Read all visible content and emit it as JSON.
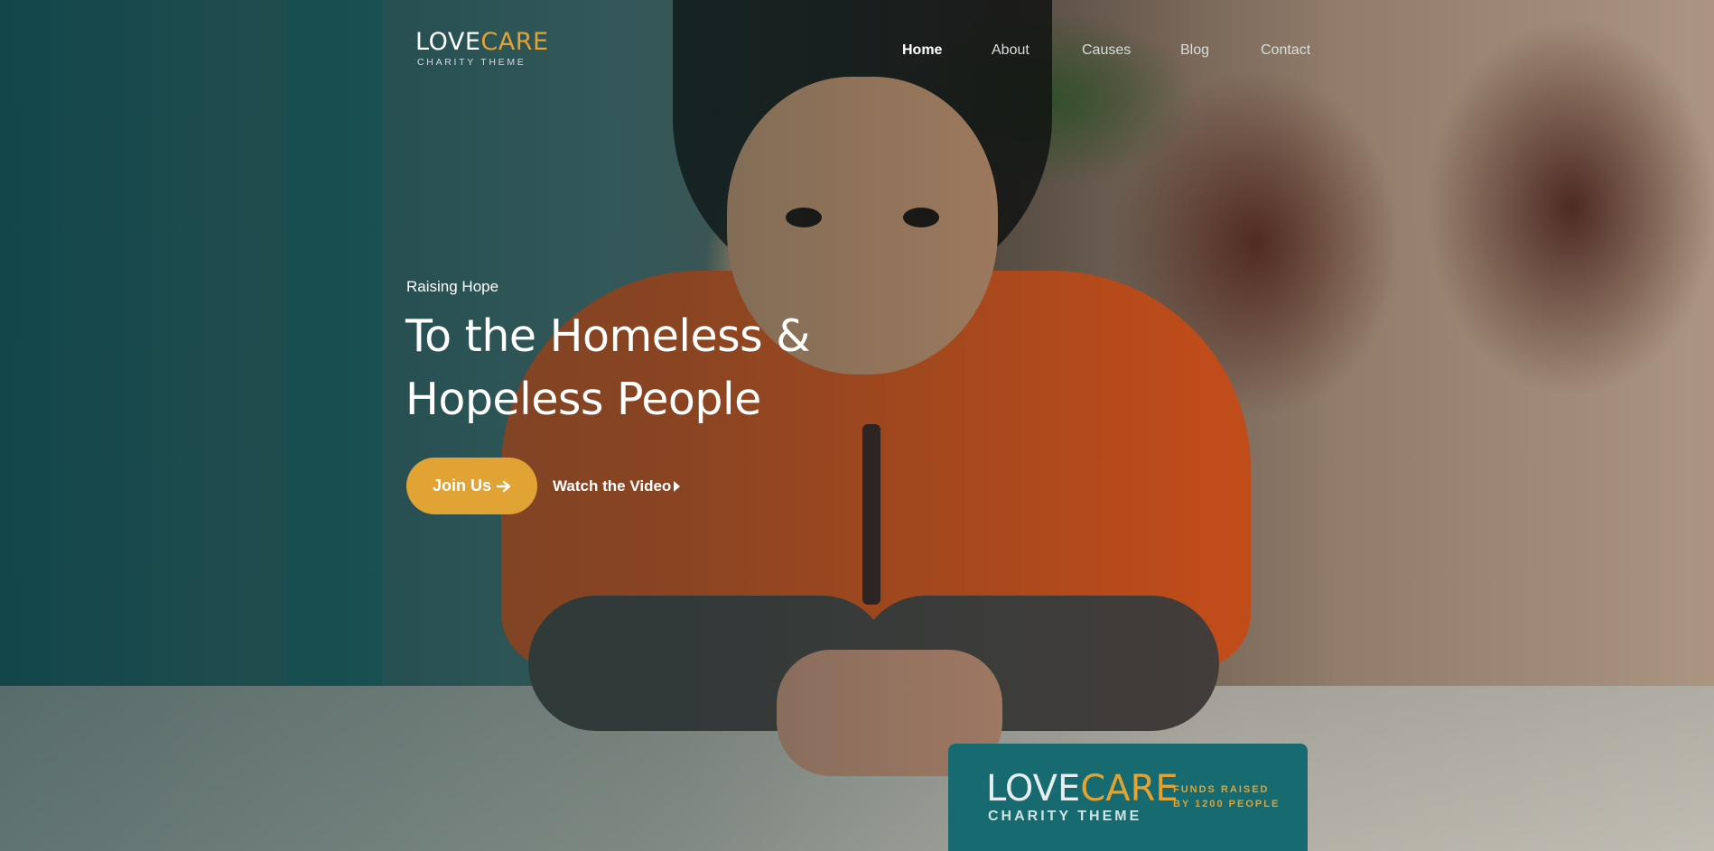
{
  "brand": {
    "word_light": "LOVE",
    "word_accent": "CARE",
    "tagline": "CHARITY THEME",
    "accent_color": "#e0a334",
    "teal_color": "#166a70"
  },
  "nav": {
    "items": [
      {
        "label": "Home",
        "active": true
      },
      {
        "label": "About",
        "active": false
      },
      {
        "label": "Causes",
        "active": false
      },
      {
        "label": "Blog",
        "active": false
      },
      {
        "label": "Contact",
        "active": false
      }
    ]
  },
  "hero": {
    "eyebrow": "Raising Hope",
    "headline_line1": "To the Homeless &",
    "headline_line2": "Hopeless People",
    "primary_button": "Join Us",
    "primary_icon": "arrow-right-icon",
    "secondary_link": "Watch the Video",
    "secondary_icon": "play-icon"
  },
  "badge": {
    "word_light": "LOVE",
    "word_accent": "CARE",
    "tagline": "CHARITY THEME",
    "funds_line1": "FUNDS RAISED",
    "funds_line2": "BY 1200 PEOPLE"
  }
}
